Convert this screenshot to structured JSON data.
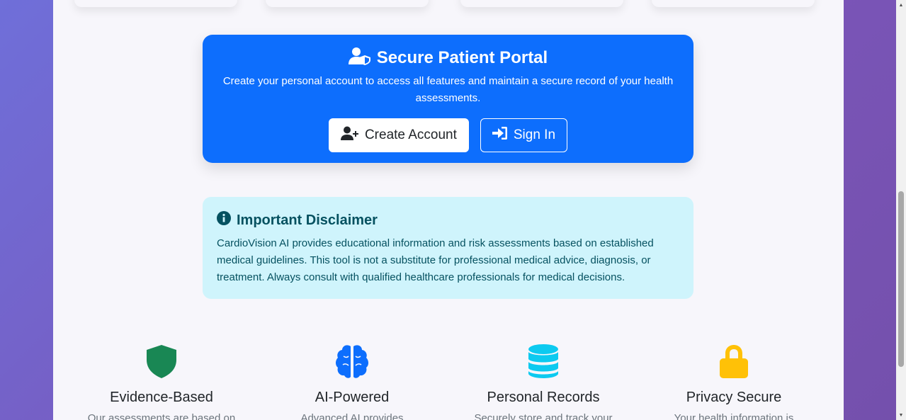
{
  "portal": {
    "title": "Secure Patient Portal",
    "description": "Create your personal account to access all features and maintain a secure record of your health assessments.",
    "create_account_label": "Create Account",
    "sign_in_label": "Sign In"
  },
  "disclaimer": {
    "title": "Important Disclaimer",
    "text": "CardioVision AI provides educational information and risk assessments based on established medical guidelines. This tool is not a substitute for professional medical advice, diagnosis, or treatment. Always consult with qualified healthcare professionals for medical decisions."
  },
  "features": [
    {
      "title": "Evidence-Based",
      "description": "Our assessments are based on",
      "icon": "shield-icon",
      "color": "#198754"
    },
    {
      "title": "AI-Powered",
      "description": "Advanced AI provides",
      "icon": "brain-icon",
      "color": "#0d6efd"
    },
    {
      "title": "Personal Records",
      "description": "Securely store and track your",
      "icon": "database-icon",
      "color": "#0dcaf0"
    },
    {
      "title": "Privacy Secure",
      "description": "Your health information is",
      "icon": "lock-icon",
      "color": "#ffc107"
    }
  ],
  "colors": {
    "primary": "#0d6efd",
    "info_bg": "#cff4fc",
    "info_text": "#055160"
  }
}
